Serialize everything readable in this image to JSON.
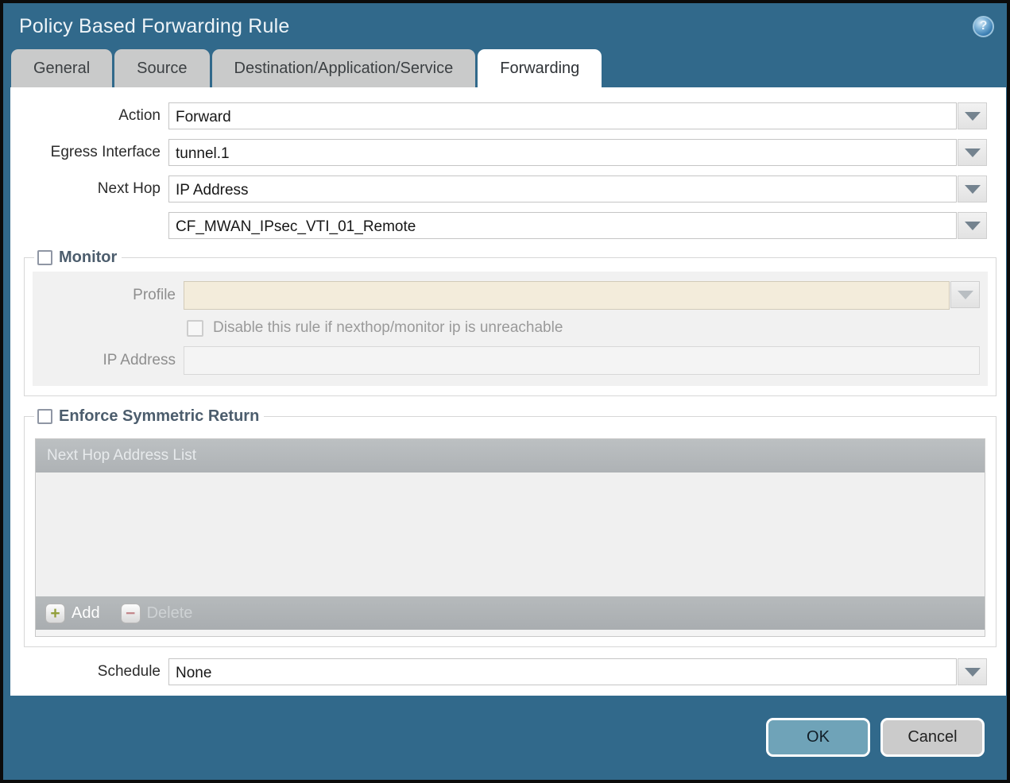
{
  "window": {
    "title": "Policy Based Forwarding Rule",
    "help_icon_glyph": "?"
  },
  "tabs": [
    {
      "label": "General",
      "active": false
    },
    {
      "label": "Source",
      "active": false
    },
    {
      "label": "Destination/Application/Service",
      "active": false
    },
    {
      "label": "Forwarding",
      "active": true
    }
  ],
  "form": {
    "action": {
      "label": "Action",
      "value": "Forward"
    },
    "egress_interface": {
      "label": "Egress Interface",
      "value": "tunnel.1"
    },
    "next_hop": {
      "label": "Next Hop",
      "value": "IP Address"
    },
    "next_hop_address": {
      "value": "CF_MWAN_IPsec_VTI_01_Remote"
    },
    "schedule": {
      "label": "Schedule",
      "value": "None"
    }
  },
  "monitor": {
    "title": "Monitor",
    "checked": false,
    "profile": {
      "label": "Profile",
      "value": ""
    },
    "disable_rule_checkbox": {
      "label": "Disable this rule if nexthop/monitor ip is unreachable",
      "checked": false
    },
    "ip_address": {
      "label": "IP Address",
      "value": ""
    }
  },
  "symmetric_return": {
    "title": "Enforce Symmetric Return",
    "checked": false,
    "table": {
      "header": "Next Hop Address List",
      "rows": []
    },
    "add_button": "Add",
    "delete_button": "Delete",
    "add_icon_glyph": "+",
    "delete_icon_glyph": "−"
  },
  "footer": {
    "ok": "OK",
    "cancel": "Cancel"
  },
  "colors": {
    "titlebar_teal": "#31698b",
    "tab_inactive": "#c9caca",
    "tab_active": "#ffffff",
    "profile_field_beige": "#f3ecdb",
    "section_gray": "#f1f1f1",
    "grid_header_gray": "#b5b9bb",
    "ok_button_teal": "#6fa3b8",
    "cancel_button_gray": "#cbcbcb",
    "legend_slate": "#4c5d6d"
  }
}
